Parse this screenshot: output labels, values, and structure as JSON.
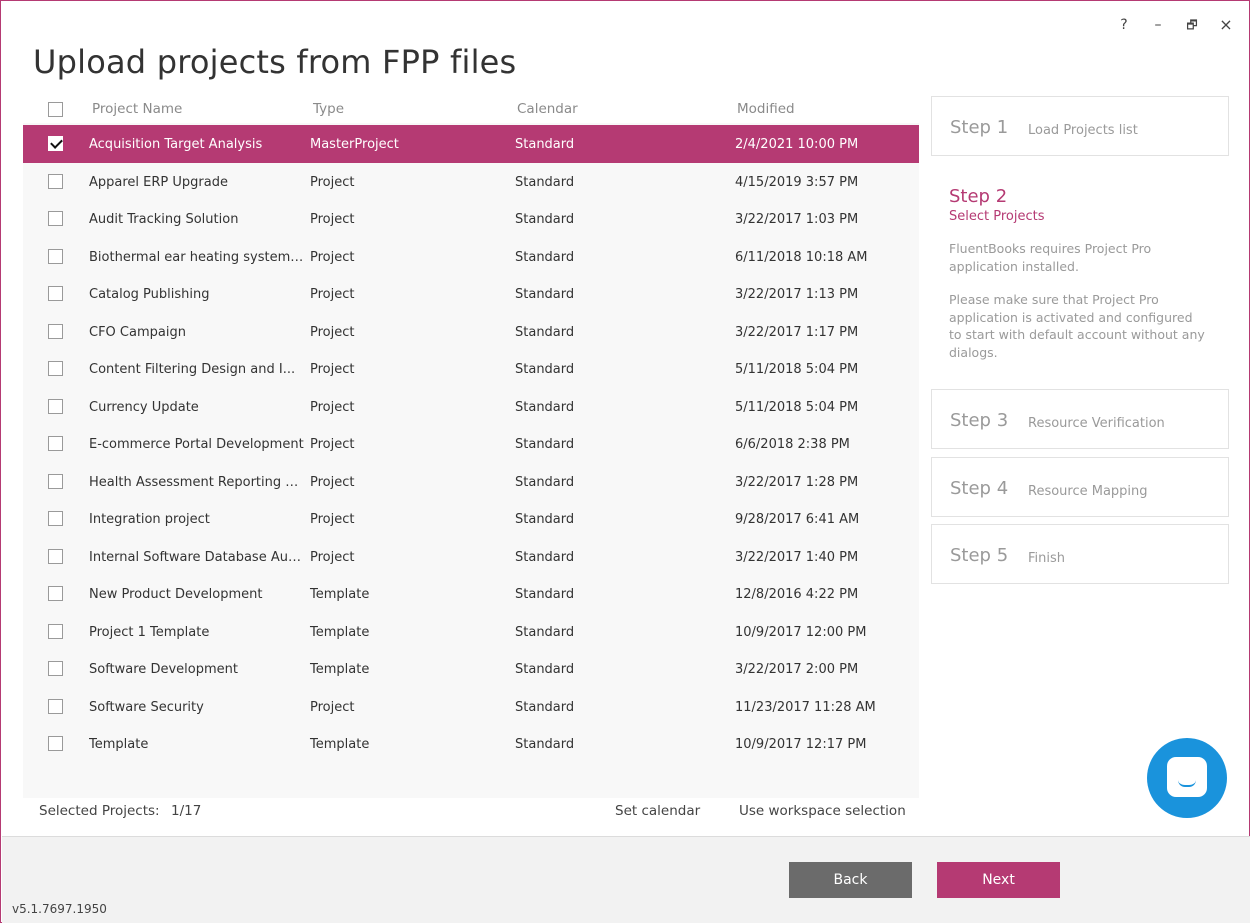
{
  "window": {
    "controls": [
      "?",
      "–",
      "🗗",
      "×"
    ]
  },
  "title": "Upload projects from FPP files",
  "table": {
    "headers": {
      "name": "Project Name",
      "type": "Type",
      "calendar": "Calendar",
      "modified": "Modified"
    },
    "rows": [
      {
        "name": "Acquisition Target Analysis",
        "type": "MasterProject",
        "calendar": "Standard",
        "modified": "2/4/2021 10:00 PM",
        "checked": true
      },
      {
        "name": "Apparel ERP Upgrade",
        "type": "Project",
        "calendar": "Standard",
        "modified": "4/15/2019 3:57 PM",
        "checked": false
      },
      {
        "name": "Audit Tracking Solution",
        "type": "Project",
        "calendar": "Standard",
        "modified": "3/22/2017 1:03 PM",
        "checked": false
      },
      {
        "name": "Biothermal ear heating system ...",
        "type": "Project",
        "calendar": "Standard",
        "modified": "6/11/2018 10:18 AM",
        "checked": false
      },
      {
        "name": "Catalog Publishing",
        "type": "Project",
        "calendar": "Standard",
        "modified": "3/22/2017 1:13 PM",
        "checked": false
      },
      {
        "name": "CFO Campaign",
        "type": "Project",
        "calendar": "Standard",
        "modified": "3/22/2017 1:17 PM",
        "checked": false
      },
      {
        "name": "Content Filtering Design and I...",
        "type": "Project",
        "calendar": "Standard",
        "modified": "5/11/2018 5:04 PM",
        "checked": false
      },
      {
        "name": "Currency Update",
        "type": "Project",
        "calendar": "Standard",
        "modified": "5/11/2018 5:04 PM",
        "checked": false
      },
      {
        "name": "E-commerce Portal Development",
        "type": "Project",
        "calendar": "Standard",
        "modified": "6/6/2018 2:38 PM",
        "checked": false
      },
      {
        "name": "Health Assessment Reporting T...",
        "type": "Project",
        "calendar": "Standard",
        "modified": "3/22/2017 1:28 PM",
        "checked": false
      },
      {
        "name": "Integration project",
        "type": "Project",
        "calendar": "Standard",
        "modified": "9/28/2017 6:41 AM",
        "checked": false
      },
      {
        "name": "Internal Software Database Audit",
        "type": "Project",
        "calendar": "Standard",
        "modified": "3/22/2017 1:40 PM",
        "checked": false
      },
      {
        "name": "New Product Development",
        "type": "Template",
        "calendar": "Standard",
        "modified": "12/8/2016 4:22 PM",
        "checked": false
      },
      {
        "name": "Project 1 Template",
        "type": "Template",
        "calendar": "Standard",
        "modified": "10/9/2017 12:00 PM",
        "checked": false
      },
      {
        "name": "Software Development",
        "type": "Template",
        "calendar": "Standard",
        "modified": "3/22/2017 2:00 PM",
        "checked": false
      },
      {
        "name": "Software Security",
        "type": "Project",
        "calendar": "Standard",
        "modified": "11/23/2017 11:28 AM",
        "checked": false
      },
      {
        "name": "Template",
        "type": "Template",
        "calendar": "Standard",
        "modified": "10/9/2017 12:17 PM",
        "checked": false
      }
    ]
  },
  "footer": {
    "selected_label": "Selected Projects:",
    "selected_count": "1/17",
    "set_calendar": "Set calendar",
    "use_workspace": "Use workspace selection"
  },
  "steps": {
    "step1": {
      "num": "Step 1",
      "label": "Load Projects list"
    },
    "step2": {
      "num": "Step 2",
      "label": "Select Projects",
      "desc1": "FluentBooks requires Project Pro application installed.",
      "desc2": "Please make sure that Project Pro application is activated and configured to start with default account without any dialogs."
    },
    "step3": {
      "num": "Step 3",
      "label": "Resource Verification"
    },
    "step4": {
      "num": "Step 4",
      "label": "Resource Mapping"
    },
    "step5": {
      "num": "Step 5",
      "label": "Finish"
    }
  },
  "buttons": {
    "back": "Back",
    "next": "Next"
  },
  "version": "v5.1.7697.1950",
  "colors": {
    "accent": "#b53a73",
    "back_button": "#6b6b6b",
    "chat": "#1a93dc"
  },
  "icons": [
    "help-icon",
    "minimize-icon",
    "restore-icon",
    "close-icon",
    "chat-icon"
  ]
}
